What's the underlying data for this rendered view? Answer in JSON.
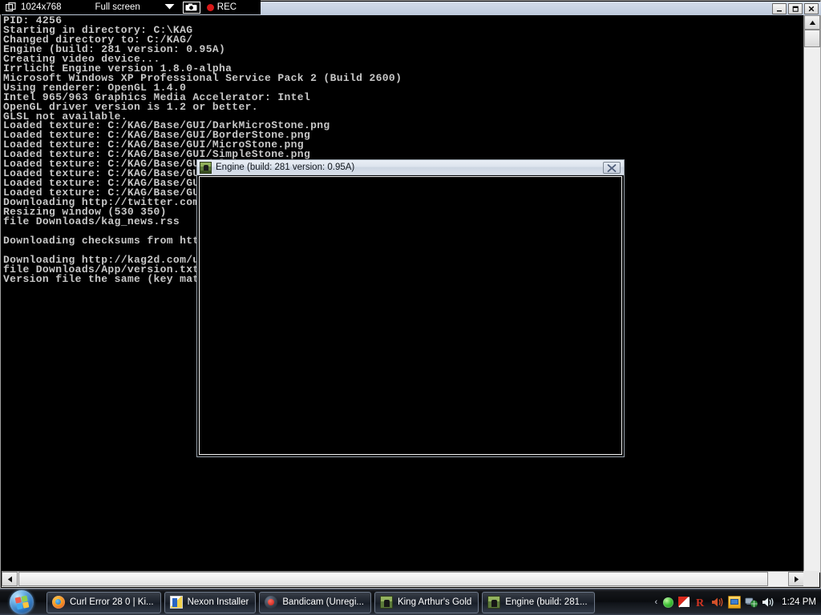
{
  "bandicam_bar": {
    "resolution": "1024x768",
    "mode": "Full screen",
    "dropdown_icon": "chevron-down-icon",
    "camera_icon": "camera-icon",
    "rec_label": "REC",
    "window_icon": "window-overlay-icon"
  },
  "console_window": {
    "title": "",
    "minimize_label": "–",
    "maximize_label": "❐",
    "close_label": "✕",
    "text": "PID: 4256\nStarting in directory: C:\\KAG\nChanged directory to: C:/KAG/\nEngine (build: 281 version: 0.95A)\nCreating video device...\nIrrlicht Engine version 1.8.0-alpha\nMicrosoft Windows XP Professional Service Pack 2 (Build 2600)\nUsing renderer: OpenGL 1.4.0\nIntel 965/963 Graphics Media Accelerator: Intel\nOpenGL driver version is 1.2 or better.\nGLSL not available.\nLoaded texture: C:/KAG/Base/GUI/DarkMicroStone.png\nLoaded texture: C:/KAG/Base/GUI/BorderStone.png\nLoaded texture: C:/KAG/Base/GUI/MicroStone.png\nLoaded texture: C:/KAG/Base/GUI/SimpleStone.png\nLoaded texture: C:/KAG/Base/GUI/PlainStone.png\nLoaded texture: C:/KAG/Base/GUI/CheckBox.png\nLoaded texture: C:/KAG/Base/GUI/Slider.png\nLoaded texture: C:/KAG/Base/GUI/Button.png\nDownloading http://twitter.com/statuses/user_timeline/kag2d.rss\nResizing window (530 350)\nfile Downloads/kag_news.rss\n\nDownloading checksums from http://kag2d.com/update/checksums.txt\n\nDownloading http://kag2d.com/update/version.txt\nfile Downloads/App/version.txt\nVersion file the same (key matches)"
  },
  "engine_window": {
    "title": "Engine (build: 281 version: 0.95A)",
    "icon": "kag-app-icon",
    "close_label": "✖"
  },
  "taskbar": {
    "start_icon": "windows-start-orb-icon",
    "buttons": [
      {
        "label": "Curl Error 28 0 | Ki...",
        "icon": "firefox-icon"
      },
      {
        "label": "Nexon Installer",
        "icon": "nexon-installer-icon"
      },
      {
        "label": "Bandicam (Unregi...",
        "icon": "bandicam-icon"
      },
      {
        "label": "King Arthur's Gold",
        "icon": "kag-icon"
      },
      {
        "label": "Engine (build: 281...",
        "icon": "kag-icon"
      }
    ],
    "tray": {
      "chevron": "‹",
      "icons": [
        "green-status-icon",
        "kaspersky-icon",
        "r-app-icon",
        "speaker-mute-icon",
        "update-notice-icon",
        "network-icon",
        "volume-icon"
      ],
      "clock": "1:24 PM"
    }
  },
  "colors": {
    "console_bg": "#000000",
    "console_text": "#c8c8c8",
    "titlebar": "#cdd7e5",
    "taskbar": "#0d1014",
    "rec_red": "#d81818",
    "accent_blue": "#2a72bd"
  }
}
